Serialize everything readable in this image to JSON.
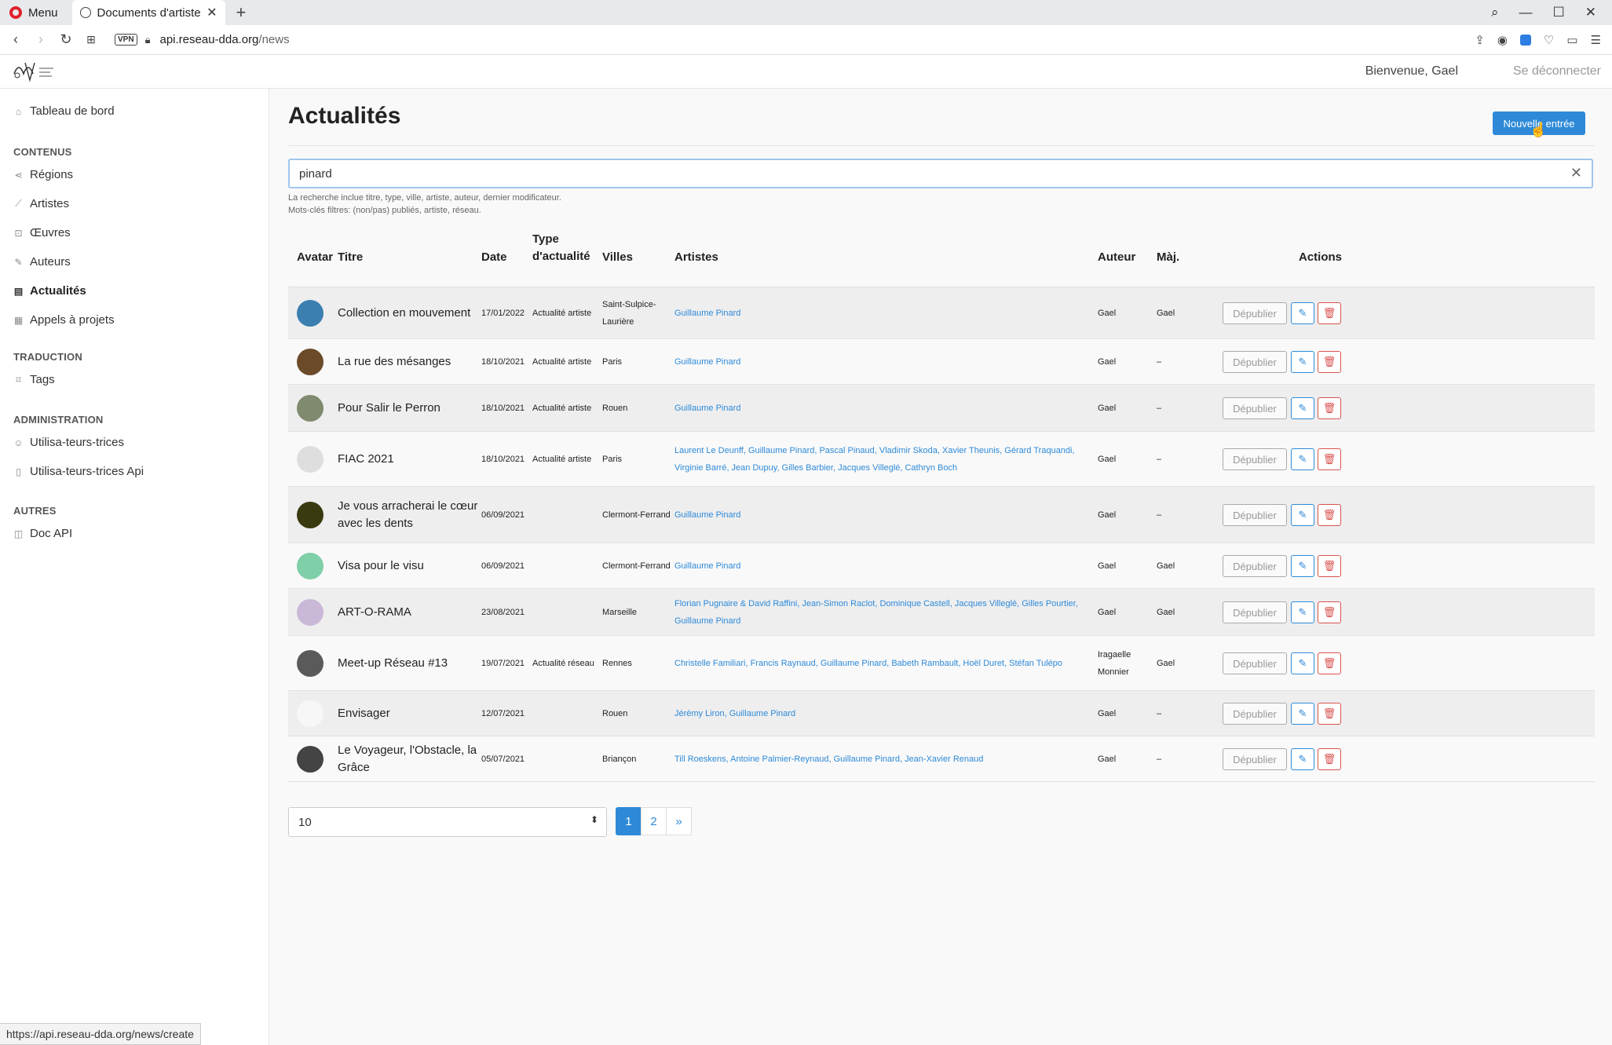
{
  "browser": {
    "menu_label": "Menu",
    "tab_title": "Documents d'artistes - A",
    "url_host": "api.reseau-dda.org",
    "url_path": "/news",
    "vpn_label": "VPN",
    "status_url": "https://api.reseau-dda.org/news/create"
  },
  "header": {
    "welcome": "Bienvenue, Gael",
    "logout": "Se déconnecter"
  },
  "sidebar": {
    "dashboard": "Tableau de bord",
    "sections": [
      {
        "heading": "CONTENUS",
        "items": [
          "Régions",
          "Artistes",
          "Œuvres",
          "Auteurs",
          "Actualités",
          "Appels à projets"
        ]
      },
      {
        "heading": "TRADUCTION",
        "items": [
          "Tags"
        ]
      },
      {
        "heading": "ADMINISTRATION",
        "items": [
          "Utilisa-teurs-trices",
          "Utilisa-teurs-trices Api"
        ]
      },
      {
        "heading": "AUTRES",
        "items": [
          "Doc API"
        ]
      }
    ],
    "active_item": "Actualités"
  },
  "main": {
    "title": "Actualités",
    "new_button": "Nouvelle entrée",
    "search_value": "pinard",
    "help_line1": "La recherche inclue titre, type, ville, artiste, auteur, dernier modificateur.",
    "help_line2": "Mots-clés filtres: (non/pas) publiés, artiste, réseau."
  },
  "table": {
    "headers": {
      "avatar": "Avatar",
      "title": "Titre",
      "date": "Date",
      "type_line1": "Type",
      "type_line2": "d'actualité",
      "cities": "Villes",
      "artists": "Artistes",
      "author": "Auteur",
      "updated": "Màj.",
      "actions": "Actions"
    },
    "unpublish_label": "Dépublier",
    "rows": [
      {
        "title": "Collection en mouvement",
        "date": "17/01/2022",
        "type": "Actualité artiste",
        "city": "Saint-Sulpice-Laurière",
        "artists": "Guillaume Pinard",
        "author": "Gael",
        "updated": "Gael",
        "avatar_color": "#3a7fb0"
      },
      {
        "title": "La rue des mésanges",
        "date": "18/10/2021",
        "type": "Actualité artiste",
        "city": "Paris",
        "artists": "Guillaume Pinard",
        "author": "Gael",
        "updated": "–",
        "avatar_color": "#6b4a2a"
      },
      {
        "title": "Pour Salir le Perron",
        "date": "18/10/2021",
        "type": "Actualité artiste",
        "city": "Rouen",
        "artists": "Guillaume Pinard",
        "author": "Gael",
        "updated": "–",
        "avatar_color": "#7f8a6e"
      },
      {
        "title": "FIAC 2021",
        "date": "18/10/2021",
        "type": "Actualité artiste",
        "city": "Paris",
        "artists": "Laurent Le Deunff, Guillaume Pinard, Pascal Pinaud, Vladimir Skoda, Xavier Theunis, Gérard Traquandi, Virginie Barré, Jean Dupuy, Gilles Barbier, Jacques Villeglé, Cathryn Boch",
        "author": "Gael",
        "updated": "–",
        "avatar_color": "#dedede"
      },
      {
        "title": "Je vous arracherai le cœur avec les dents",
        "date": "06/09/2021",
        "type": "",
        "city": "Clermont-Ferrand",
        "artists": "Guillaume Pinard",
        "author": "Gael",
        "updated": "–",
        "avatar_color": "#3a3a10"
      },
      {
        "title": "Visa pour le visu",
        "date": "06/09/2021",
        "type": "",
        "city": "Clermont-Ferrand",
        "artists": "Guillaume Pinard",
        "author": "Gael",
        "updated": "Gael",
        "avatar_color": "#7fcfa8"
      },
      {
        "title": "ART-O-RAMA",
        "date": "23/08/2021",
        "type": "",
        "city": "Marseille",
        "artists": "Florian Pugnaire & David Raffini, Jean-Simon Raclot, Dominique Castell, Jacques Villeglé, Gilles Pourtier, Guillaume Pinard",
        "author": "Gael",
        "updated": "Gael",
        "avatar_color": "#c9b8d8"
      },
      {
        "title": "Meet-up Réseau #13",
        "date": "19/07/2021",
        "type": "Actualité réseau",
        "city": "Rennes",
        "artists": "Christelle Familiari, Francis Raynaud, Guillaume Pinard, Babeth Rambault, Hoël Duret, Stéfan Tulépo",
        "author": "Iragaelle Monnier",
        "updated": "Gael",
        "avatar_color": "#5a5a5a"
      },
      {
        "title": "Envisager",
        "date": "12/07/2021",
        "type": "",
        "city": "Rouen",
        "artists": "Jérémy Liron, Guillaume Pinard",
        "author": "Gael",
        "updated": "–",
        "avatar_color": "#f7f7f7"
      },
      {
        "title": "Le Voyageur, l'Obstacle, la Grâce",
        "date": "05/07/2021",
        "type": "",
        "city": "Briançon",
        "artists": "Till Roeskens, Antoine Palmier-Reynaud, Guillaume Pinard, Jean-Xavier Renaud",
        "author": "Gael",
        "updated": "–",
        "avatar_color": "#444444"
      }
    ]
  },
  "pagination": {
    "per_page": "10",
    "pages": [
      "1",
      "2",
      "»"
    ],
    "current": "1"
  },
  "colors": {
    "accent": "#2e8ad8",
    "danger": "#d9534f"
  }
}
